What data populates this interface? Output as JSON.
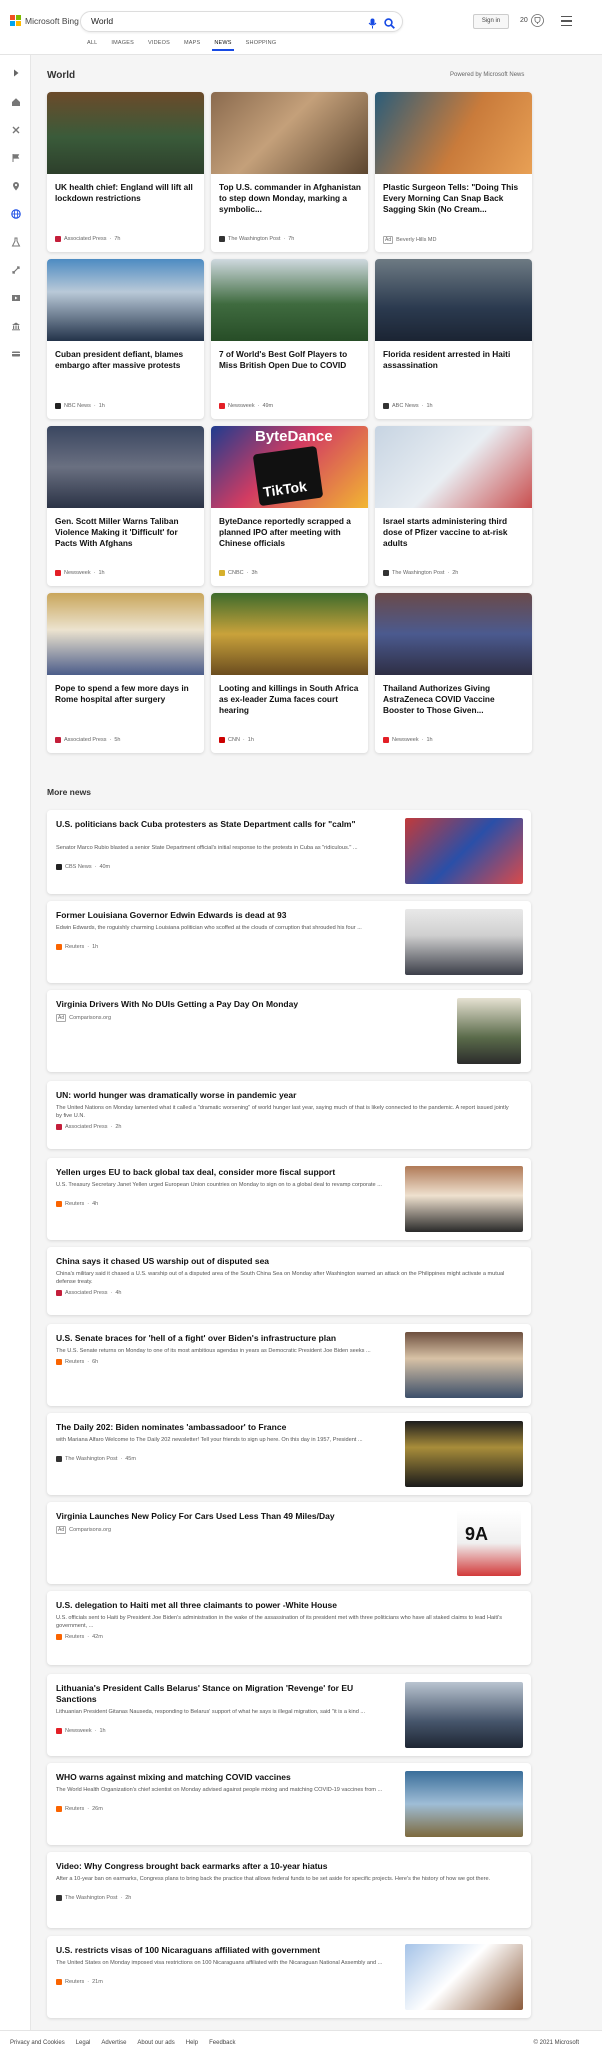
{
  "header": {
    "logo_text": "Microsoft Bing",
    "search_value": "World",
    "signin_label": "Sign in",
    "points": "20"
  },
  "nav": [
    "ALL",
    "IMAGES",
    "VIDEOS",
    "MAPS",
    "NEWS",
    "SHOPPING"
  ],
  "nav_active": "NEWS",
  "section": {
    "title": "World",
    "powered_by": "Powered by Microsoft News"
  },
  "cards": [
    {
      "title": "UK health chief: England will lift all lockdown restrictions",
      "source": "Associated Press",
      "time": "7h",
      "ad": false
    },
    {
      "title": "Top U.S. commander in Afghanistan to step down Monday, marking a symbolic...",
      "source": "The Washington Post",
      "time": "7h",
      "ad": false
    },
    {
      "title": "Plastic Surgeon Tells: \"Doing This Every Morning Can Snap Back Sagging Skin (No Cream...",
      "source": "Beverly Hills MD",
      "time": "",
      "ad": true,
      "ad_label": "Ad"
    },
    {
      "title": "Cuban president defiant, blames embargo after massive protests",
      "source": "NBC News",
      "time": "1h",
      "ad": false
    },
    {
      "title": "7 of World's Best Golf Players to Miss British Open Due to COVID",
      "source": "Newsweek",
      "time": "49m",
      "ad": false
    },
    {
      "title": "Florida resident arrested in Haiti assassination",
      "source": "ABC News",
      "time": "1h",
      "ad": false
    },
    {
      "title": "Gen. Scott Miller Warns Taliban Violence Making it 'Difficult' for Pacts With Afghans",
      "source": "Newsweek",
      "time": "1h",
      "ad": false
    },
    {
      "title": "ByteDance reportedly scrapped a planned IPO after meeting with Chinese officials",
      "source": "CNBC",
      "time": "3h",
      "ad": false
    },
    {
      "title": "Israel starts administering third dose of Pfizer vaccine to at-risk adults",
      "source": "The Washington Post",
      "time": "2h",
      "ad": false
    },
    {
      "title": "Pope to spend a few more days in Rome hospital after surgery",
      "source": "Associated Press",
      "time": "5h",
      "ad": false
    },
    {
      "title": "Looting and killings in South Africa as ex-leader Zuma faces court hearing",
      "source": "CNN",
      "time": "1h",
      "ad": false
    },
    {
      "title": "Thailand Authorizes Giving AstraZeneca COVID Vaccine Booster to Those Given...",
      "source": "Newsweek",
      "time": "1h",
      "ad": false
    }
  ],
  "more_news_title": "More news",
  "rows": [
    {
      "title": "U.S. politicians back Cuba protesters as State Department calls for \"calm\"",
      "desc": "Senator Marco Rubio blasted a senior State Department official's initial response to the protests in Cuba as \"ridiculous.\" ...",
      "source": "CBS News",
      "time": "40m",
      "ad": false
    },
    {
      "title": "Former Louisiana Governor Edwin Edwards is dead at 93",
      "desc": "Edwin Edwards, the roguishly charming Louisiana politician who scoffed at the clouds of corruption that shrouded his four ...",
      "source": "Reuters",
      "time": "1h",
      "ad": false
    },
    {
      "title": "Virginia Drivers With No DUIs Getting a Pay Day On Monday",
      "desc": "",
      "source": "Comparisons.org",
      "time": "",
      "ad": true,
      "ad_label": "Ad"
    },
    {
      "title": "UN: world hunger was dramatically worse in pandemic year",
      "desc": "The United Nations on Monday lamented what it called a \"dramatic worsening\" of world hunger last year, saying much of that is likely connected to the pandemic. A report issued jointly by five U.N.",
      "source": "Associated Press",
      "time": "2h",
      "ad": false
    },
    {
      "title": "Yellen urges EU to back global tax deal, consider more fiscal support",
      "desc": "U.S. Treasury Secretary Janet Yellen urged European Union countries on Monday to sign on to a global deal to revamp corporate ...",
      "source": "Reuters",
      "time": "4h",
      "ad": false
    },
    {
      "title": "China says it chased US warship out of disputed sea",
      "desc": "China's military said it chased a U.S. warship out of a disputed area of the South China Sea on Monday after Washington warned an attack on the Philippines might activate a mutual defense treaty.",
      "source": "Associated Press",
      "time": "4h",
      "ad": false
    },
    {
      "title": "U.S. Senate braces for 'hell of a fight' over Biden's infrastructure plan",
      "desc": "The U.S. Senate returns on Monday to one of its most ambitious agendas in years as Democratic President Joe Biden seeks ...",
      "source": "Reuters",
      "time": "6h",
      "ad": false
    },
    {
      "title": "The Daily 202: Biden nominates 'ambassadoor' to France",
      "desc": "with Mariana Alfaro Welcome to The Daily 202 newsletter! Tell your friends to sign up here. On this day in 1957, President ...",
      "source": "The Washington Post",
      "time": "45m",
      "ad": false
    },
    {
      "title": "Virginia Launches New Policy For Cars Used Less Than 49 Miles/Day",
      "desc": "",
      "source": "Comparisons.org",
      "time": "",
      "ad": true,
      "ad_label": "Ad"
    },
    {
      "title": "U.S. delegation to Haiti met all three claimants to power -White House",
      "desc": "U.S. officials sent to Haiti by President Joe Biden's administration in the wake of the assassination of its president met with three politicians who have all staked claims to lead Haiti's government, ...",
      "source": "Reuters",
      "time": "42m",
      "ad": false
    },
    {
      "title": "Lithuania's President Calls Belarus' Stance on Migration 'Revenge' for EU Sanctions",
      "desc": "Lithuanian President Gitanas Nauseda, responding to Belarus' support of what he says is illegal migration, said \"it is a kind ...",
      "source": "Newsweek",
      "time": "1h",
      "ad": false
    },
    {
      "title": "WHO warns against mixing and matching COVID vaccines",
      "desc": "The World Health Organization's chief scientist on Monday advised against people mixing and matching COVID-19 vaccines from ...",
      "source": "Reuters",
      "time": "26m",
      "ad": false
    },
    {
      "title": "Video: Why Congress brought back earmarks after a 10-year hiatus",
      "desc": "After a 10-year ban on earmarks, Congress plans to bring back the practice that allows federal funds to be set aside for specific projects. Here's the history of how we got there.",
      "source": "The Washington Post",
      "time": "2h",
      "ad": false
    },
    {
      "title": "U.S. restricts visas of 100 Nicaraguans affiliated with government",
      "desc": "The United States on Monday imposed visa restrictions on 100 Nicaraguans affiliated with the Nicaraguan National Assembly and ...",
      "source": "Reuters",
      "time": "21m",
      "ad": false
    }
  ],
  "thumb_texts": {
    "bytedance": "ByteDance",
    "tiktok": "TikTok",
    "plate": "9A"
  },
  "footer": {
    "links": [
      "Privacy and Cookies",
      "Legal",
      "Advertise",
      "About our ads",
      "Help",
      "Feedback"
    ],
    "copyright": "© 2021 Microsoft"
  },
  "colors": {
    "accent": "#174ae4",
    "ms_red": "#f25022",
    "ms_green": "#7fba00",
    "ms_blue": "#00a4ef",
    "ms_yellow": "#ffb900"
  }
}
